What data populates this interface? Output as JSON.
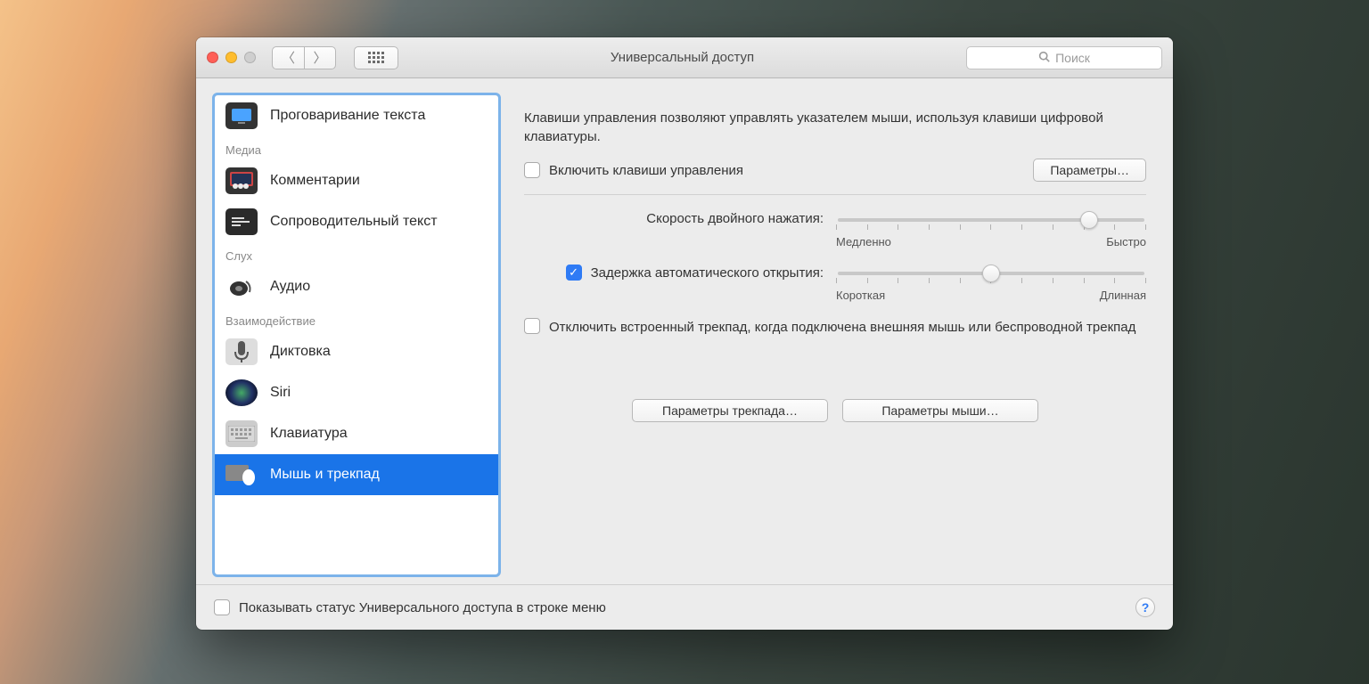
{
  "window": {
    "title": "Универсальный доступ"
  },
  "search": {
    "placeholder": "Поиск"
  },
  "sidebar": {
    "sections": [
      {
        "label": "",
        "items": [
          {
            "label": "Проговаривание текста"
          }
        ]
      },
      {
        "label": "Медиа",
        "items": [
          {
            "label": "Комментарии"
          },
          {
            "label": "Сопроводительный текст"
          }
        ]
      },
      {
        "label": "Слух",
        "items": [
          {
            "label": "Аудио"
          }
        ]
      },
      {
        "label": "Взаимодействие",
        "items": [
          {
            "label": "Диктовка"
          },
          {
            "label": "Siri"
          },
          {
            "label": "Клавиатура"
          },
          {
            "label": "Мышь и трекпад",
            "selected": true
          }
        ]
      }
    ]
  },
  "main": {
    "description": "Клавиши управления позволяют управлять указателем мыши, используя клавиши цифровой клавиатуры.",
    "enable_keys_label": "Включить клавиши управления",
    "options_button": "Параметры…",
    "double_click_label": "Скорость двойного нажатия:",
    "double_click_min": "Медленно",
    "double_click_max": "Быстро",
    "spring_label": "Задержка автоматического открытия:",
    "spring_min": "Короткая",
    "spring_max": "Длинная",
    "ignore_trackpad_label": "Отключить встроенный трекпад, когда подключена внешняя мышь или беспроводной трекпад",
    "trackpad_options_button": "Параметры трекпада…",
    "mouse_options_button": "Параметры мыши…"
  },
  "footer": {
    "show_status_label": "Показывать статус Универсального доступа в строке меню"
  }
}
